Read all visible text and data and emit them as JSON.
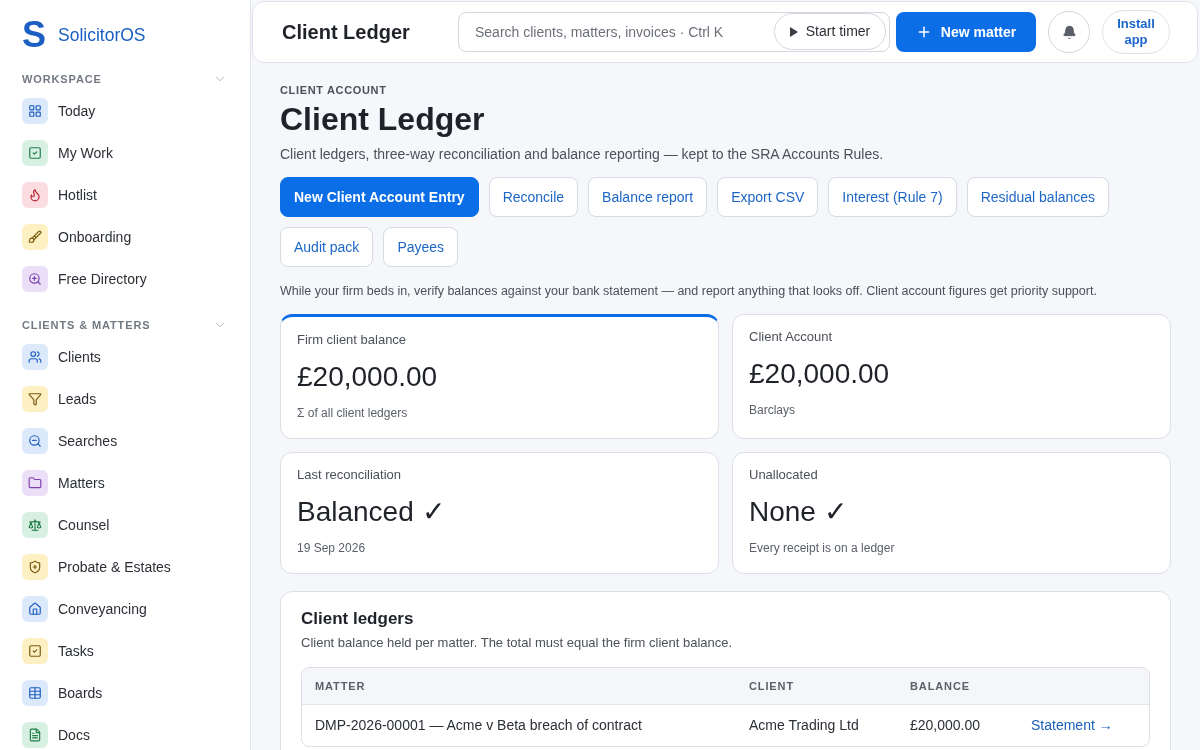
{
  "sidebar": {
    "brand": {
      "mark": "S",
      "name": "SolicitorOS"
    },
    "sections": [
      {
        "title": "WORKSPACE",
        "expanded": true,
        "items": [
          {
            "label": "Today",
            "selected": false
          },
          {
            "label": "My Work",
            "selected": false
          },
          {
            "label": "Hotlist",
            "selected": false
          },
          {
            "label": "Onboarding",
            "selected": false
          },
          {
            "label": "Free Directory",
            "selected": false
          }
        ]
      },
      {
        "title": "CLIENTS & MATTERS",
        "expanded": true,
        "items": [
          {
            "label": "Clients",
            "selected": false
          },
          {
            "label": "Leads",
            "selected": false
          },
          {
            "label": "Searches",
            "selected": false
          },
          {
            "label": "Matters",
            "selected": false
          },
          {
            "label": "Counsel",
            "selected": false
          },
          {
            "label": "Probate & Estates",
            "selected": false
          },
          {
            "label": "Conveyancing",
            "selected": false
          },
          {
            "label": "Tasks",
            "selected": false
          },
          {
            "label": "Boards",
            "selected": false
          },
          {
            "label": "Docs",
            "selected": false
          }
        ]
      }
    ]
  },
  "header": {
    "title": "Client Ledger",
    "search": {
      "placeholder": "Search clients, matters, invoices · Ctrl K"
    },
    "start_timer": "Start timer",
    "new_matter": "New matter",
    "install_app": "Install app"
  },
  "page": {
    "eyebrow": "CLIENT ACCOUNT",
    "title": "Client Ledger",
    "subtitle": "Client ledgers, three-way reconciliation and balance reporting — kept to the SRA Accounts Rules.",
    "actions": [
      {
        "label": "New Client Account Entry",
        "kind": "primary"
      },
      {
        "label": "Reconcile",
        "kind": "secondary"
      },
      {
        "label": "Balance report",
        "kind": "secondary"
      },
      {
        "label": "Export CSV",
        "kind": "secondary"
      },
      {
        "label": "Interest (Rule 7)",
        "kind": "secondary"
      },
      {
        "label": "Residual balances",
        "kind": "secondary"
      },
      {
        "label": "Audit pack",
        "kind": "secondary"
      },
      {
        "label": "Payees",
        "kind": "secondary"
      }
    ],
    "notice": "While your firm beds in, verify balances against your bank statement — and report anything that looks off. Client account figures get priority support."
  },
  "stats": [
    {
      "label": "Firm client balance",
      "value": "£20,000.00",
      "note": "Σ of all client ledgers",
      "highlighted": true
    },
    {
      "label": "Client Account",
      "value": "£20,000.00",
      "note": "Barclays",
      "highlighted": false
    },
    {
      "label": "Last reconciliation",
      "value": "Balanced ✓",
      "note": "19 Sep 2026",
      "highlighted": false
    },
    {
      "label": "Unallocated",
      "value": "None ✓",
      "note": "Every receipt is on a ledger",
      "highlighted": false
    }
  ],
  "ledgers": {
    "title": "Client ledgers",
    "subtitle": "Client balance held per matter. The total must equal the firm client balance.",
    "table": {
      "columns": [
        "MATTER",
        "CLIENT",
        "BALANCE"
      ],
      "rows": [
        {
          "matter": "DMP-2026-00001 — Acme v Beta breach of contract",
          "client": "Acme Trading Ltd",
          "balance": "£20,000.00",
          "link": "Statement →"
        }
      ]
    }
  }
}
